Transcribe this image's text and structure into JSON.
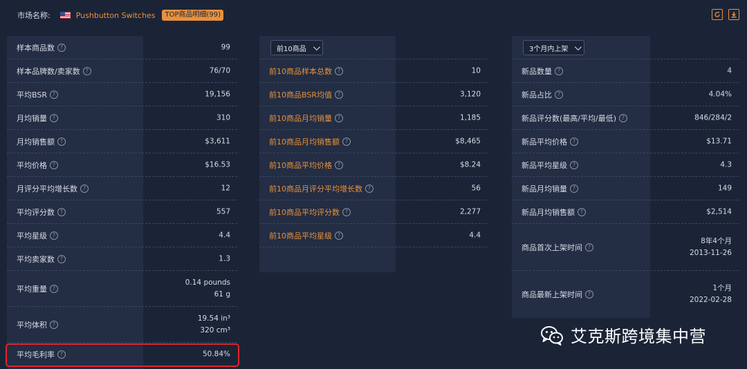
{
  "header": {
    "market_label": "市场名称:",
    "market_name": "Pushbutton Switches",
    "badge": "TOP商品明细(99)",
    "refresh_icon": "refresh-icon",
    "download_icon": "download-icon"
  },
  "panel1": {
    "rows": [
      {
        "label": "样本商品数",
        "value": "99"
      },
      {
        "label": "样本品牌数/卖家数",
        "value": "76/70"
      },
      {
        "label": "平均BSR",
        "value": "19,156"
      },
      {
        "label": "月均销量",
        "value": "310"
      },
      {
        "label": "月均销售额",
        "value": "$3,611"
      },
      {
        "label": "平均价格",
        "value": "$16.53"
      },
      {
        "label": "月评分平均增长数",
        "value": "12"
      },
      {
        "label": "平均评分数",
        "value": "557"
      },
      {
        "label": "平均星级",
        "value": "4.4"
      },
      {
        "label": "平均卖家数",
        "value": "1.3"
      },
      {
        "label": "平均重量",
        "value_line1": "0.14 pounds",
        "value_line2": "61 g"
      },
      {
        "label": "平均体积",
        "value_line1": "19.54 in³",
        "value_line2": "320 cm³"
      },
      {
        "label": "平均毛利率",
        "value": "50.84%"
      }
    ]
  },
  "panel2": {
    "select": "前10商品",
    "rows": [
      {
        "label": "前10商品样本总数",
        "value": "10"
      },
      {
        "label": "前10商品BSR均值",
        "value": "3,120"
      },
      {
        "label": "前10商品月均销量",
        "value": "1,185"
      },
      {
        "label": "前10商品月均销售额",
        "value": "$8,465"
      },
      {
        "label": "前10商品平均价格",
        "value": "$8.24"
      },
      {
        "label": "前10商品月评分平均增长数",
        "value": "56"
      },
      {
        "label": "前10商品平均评分数",
        "value": "2,277"
      },
      {
        "label": "前10商品平均星级",
        "value": "4.4"
      }
    ]
  },
  "panel3": {
    "select": "3个月内上架",
    "rows": [
      {
        "label": "新品数量",
        "value": "4"
      },
      {
        "label": "新品占比",
        "value": "4.04%"
      },
      {
        "label": "新品评分数(最高/平均/最低)",
        "value": "846/284/2"
      },
      {
        "label": "新品平均价格",
        "value": "$13.71"
      },
      {
        "label": "新品平均星级",
        "value": "4.3"
      },
      {
        "label": "新品月均销量",
        "value": "149"
      },
      {
        "label": "新品月均销售额",
        "value": "$2,514"
      },
      {
        "label": "商品首次上架时间",
        "value_line1": "8年4个月",
        "value_line2": "2013-11-26"
      },
      {
        "label": "商品最新上架时间",
        "value_line1": "1个月",
        "value_line2": "2022-02-28"
      }
    ]
  },
  "watermark": {
    "text": "艾克斯跨境集中营",
    "icon": "wechat-icon"
  },
  "colors": {
    "background": "#1b2437",
    "accent": "#e8913d",
    "highlight": "#e2242b"
  }
}
